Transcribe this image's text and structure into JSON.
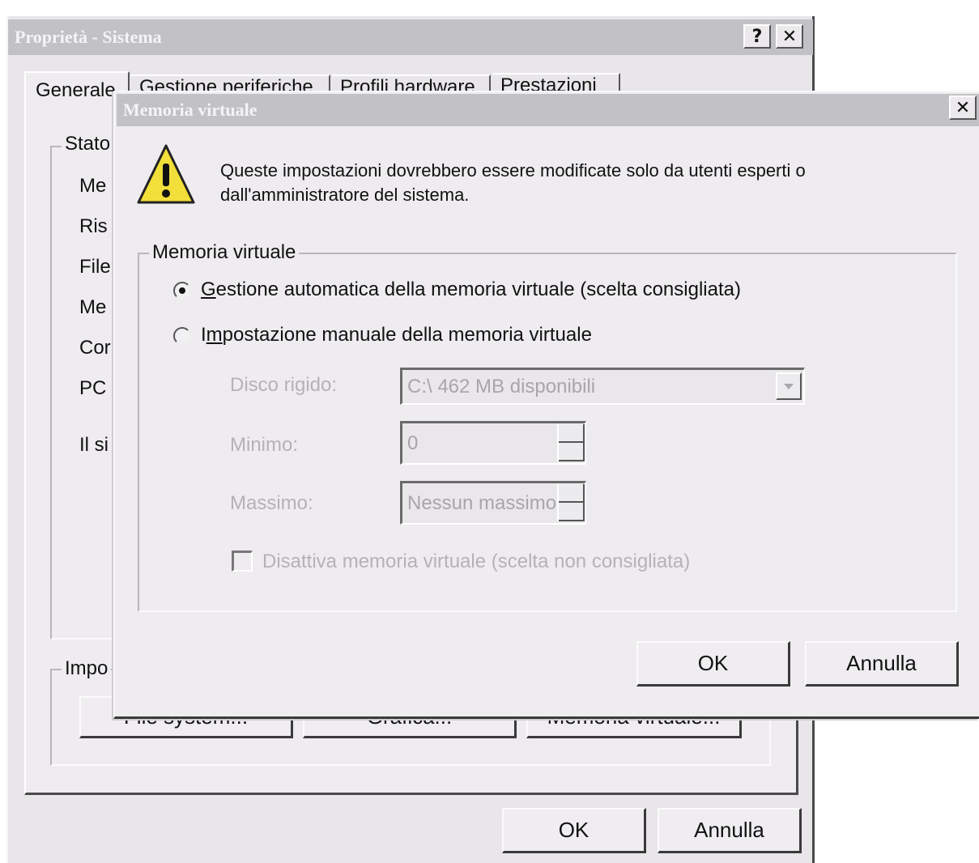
{
  "system_window": {
    "title": "Proprietà - Sistema",
    "help_label": "?",
    "close_label": "✕",
    "tabs": [
      "Generale",
      "Gestione periferiche",
      "Profili hardware",
      "Prestazioni"
    ],
    "group_stato": "Stato",
    "rows": [
      "Me",
      "Ris",
      "File",
      "Me",
      "Cor",
      "PC",
      "Il si"
    ],
    "group_impostazioni": "Impo",
    "buttons_row": [
      "File system...",
      "Grafica...",
      "Memoria virtuale..."
    ],
    "ok_label": "OK",
    "cancel_label": "Annulla"
  },
  "vm_dialog": {
    "title": "Memoria virtuale",
    "close_label": "✕",
    "warning_icon": "warning-icon",
    "warning_text_line1": "Queste impostazioni dovrebbero essere modificate solo da utenti esperti o",
    "warning_text_line2": "dall'amministratore del sistema.",
    "group_label": "Memoria virtuale",
    "radio_auto": {
      "access_key": "G",
      "rest": "estione automatica della memoria virtuale (scelta consigliata)",
      "selected": true
    },
    "radio_manual": {
      "prefix": "I",
      "access_key": "m",
      "rest": "postazione manuale della memoria virtuale",
      "selected": false
    },
    "disk_label": "Disco rigido:",
    "disk_value": "C:\\ 462 MB disponibili",
    "min_label": "Minimo:",
    "min_value": "0",
    "max_label": "Massimo:",
    "max_value": "Nessun massimo",
    "disable_checkbox_label": "Disattiva memoria virtuale (scelta non consigliata)",
    "disable_checked": false,
    "ok_label": "OK",
    "cancel_label": "Annulla"
  },
  "colors": {
    "titlebar_inactive": "#c2c2c6",
    "dialog_face": "#eeecef",
    "disabled_text": "#b5b2b7"
  }
}
